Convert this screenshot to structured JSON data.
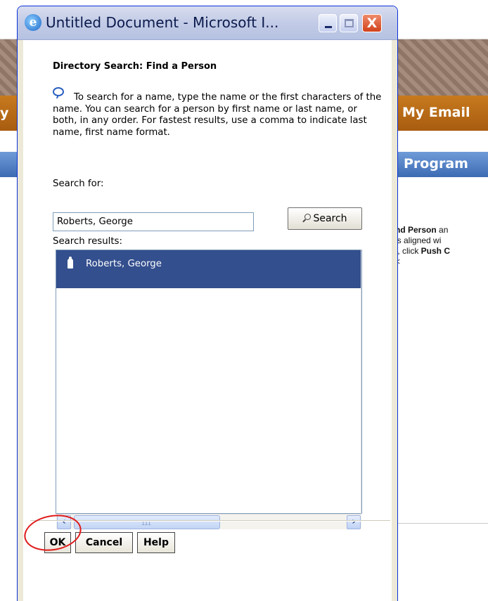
{
  "background_page": {
    "nav_left_fragment": "y",
    "nav_my_email": "My Email",
    "tab_program": "Program",
    "content_lines": [
      {
        "pre": "",
        "bold": "nd Person",
        "post": " an"
      },
      {
        "pre": " is aligned wi",
        "bold": "",
        "post": ""
      },
      {
        "pre": "t, click ",
        "bold": "Push C",
        "post": ""
      },
      {
        "pre": "<",
        "bold": "",
        "post": ""
      }
    ]
  },
  "window": {
    "title": "Untitled Document - Microsoft I...",
    "controls": {
      "minimize": "minimize",
      "maximize": "maximize",
      "close": "X"
    }
  },
  "dialog": {
    "heading": "Directory Search: Find a Person",
    "instructions": "To search for a name, type the name or the first characters of the name. You can search for a person by first name or last name, or both, in any order. For fastest results, use a comma to indicate last name, first name format.",
    "search_for_label": "Search for:",
    "search_value": "Roberts, George",
    "search_button": "Search",
    "results_label": "Search results:",
    "results": [
      "Roberts, George"
    ],
    "scroll_grip": "III",
    "buttons": {
      "ok": "OK",
      "cancel": "Cancel",
      "help": "Help"
    },
    "annotation_color": "#e01a1a",
    "selection_color": "#334f8e"
  }
}
